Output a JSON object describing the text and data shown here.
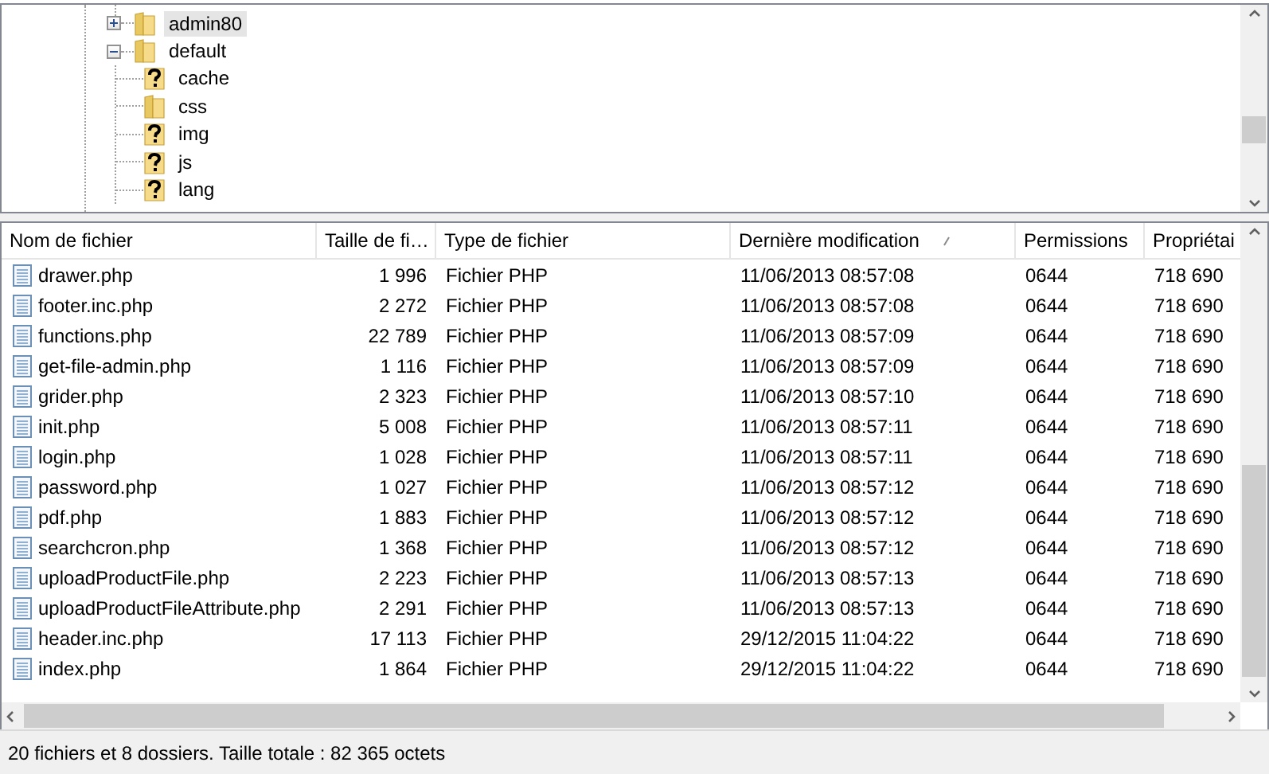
{
  "tree": {
    "items": [
      {
        "label": "admin80",
        "kind": "folder",
        "expanded": false,
        "selected": true
      },
      {
        "label": "default",
        "kind": "folder",
        "expanded": true,
        "selected": false,
        "children": [
          {
            "label": "cache",
            "kind": "unknown",
            "selected": false
          },
          {
            "label": "css",
            "kind": "folder",
            "selected": false
          },
          {
            "label": "img",
            "kind": "unknown",
            "selected": false
          },
          {
            "label": "js",
            "kind": "unknown",
            "selected": false
          },
          {
            "label": "lang",
            "kind": "unknown",
            "selected": false
          }
        ]
      }
    ]
  },
  "file_list": {
    "columns": [
      {
        "label": "Nom de fichier",
        "sorted": false
      },
      {
        "label": "Taille de fi…",
        "sorted": false
      },
      {
        "label": "Type de fichier",
        "sorted": false
      },
      {
        "label": "Dernière modification",
        "sorted": true
      },
      {
        "label": "Permissions",
        "sorted": false
      },
      {
        "label": "Propriétai",
        "sorted": false
      }
    ],
    "rows": [
      [
        "drawer.php",
        "1 996",
        "Fichier PHP",
        "11/06/2013 08:57:08",
        "0644",
        "718 690"
      ],
      [
        "footer.inc.php",
        "2 272",
        "Fichier PHP",
        "11/06/2013 08:57:08",
        "0644",
        "718 690"
      ],
      [
        "functions.php",
        "22 789",
        "Fichier PHP",
        "11/06/2013 08:57:09",
        "0644",
        "718 690"
      ],
      [
        "get-file-admin.php",
        "1 116",
        "Fichier PHP",
        "11/06/2013 08:57:09",
        "0644",
        "718 690"
      ],
      [
        "grider.php",
        "2 323",
        "Fichier PHP",
        "11/06/2013 08:57:10",
        "0644",
        "718 690"
      ],
      [
        "init.php",
        "5 008",
        "Fichier PHP",
        "11/06/2013 08:57:11",
        "0644",
        "718 690"
      ],
      [
        "login.php",
        "1 028",
        "Fichier PHP",
        "11/06/2013 08:57:11",
        "0644",
        "718 690"
      ],
      [
        "password.php",
        "1 027",
        "Fichier PHP",
        "11/06/2013 08:57:12",
        "0644",
        "718 690"
      ],
      [
        "pdf.php",
        "1 883",
        "Fichier PHP",
        "11/06/2013 08:57:12",
        "0644",
        "718 690"
      ],
      [
        "searchcron.php",
        "1 368",
        "Fichier PHP",
        "11/06/2013 08:57:12",
        "0644",
        "718 690"
      ],
      [
        "uploadProductFile.php",
        "2 223",
        "Fichier PHP",
        "11/06/2013 08:57:13",
        "0644",
        "718 690"
      ],
      [
        "uploadProductFileAttribute.php",
        "2 291",
        "Fichier PHP",
        "11/06/2013 08:57:13",
        "0644",
        "718 690"
      ],
      [
        "header.inc.php",
        "17 113",
        "Fichier PHP",
        "29/12/2015 11:04:22",
        "0644",
        "718 690"
      ],
      [
        "index.php",
        "1 864",
        "Fichier PHP",
        "29/12/2015 11:04:22",
        "0644",
        "718 690"
      ]
    ]
  },
  "status_bar": {
    "text": "20 fichiers et 8 dossiers. Taille totale : 82 365 octets"
  }
}
